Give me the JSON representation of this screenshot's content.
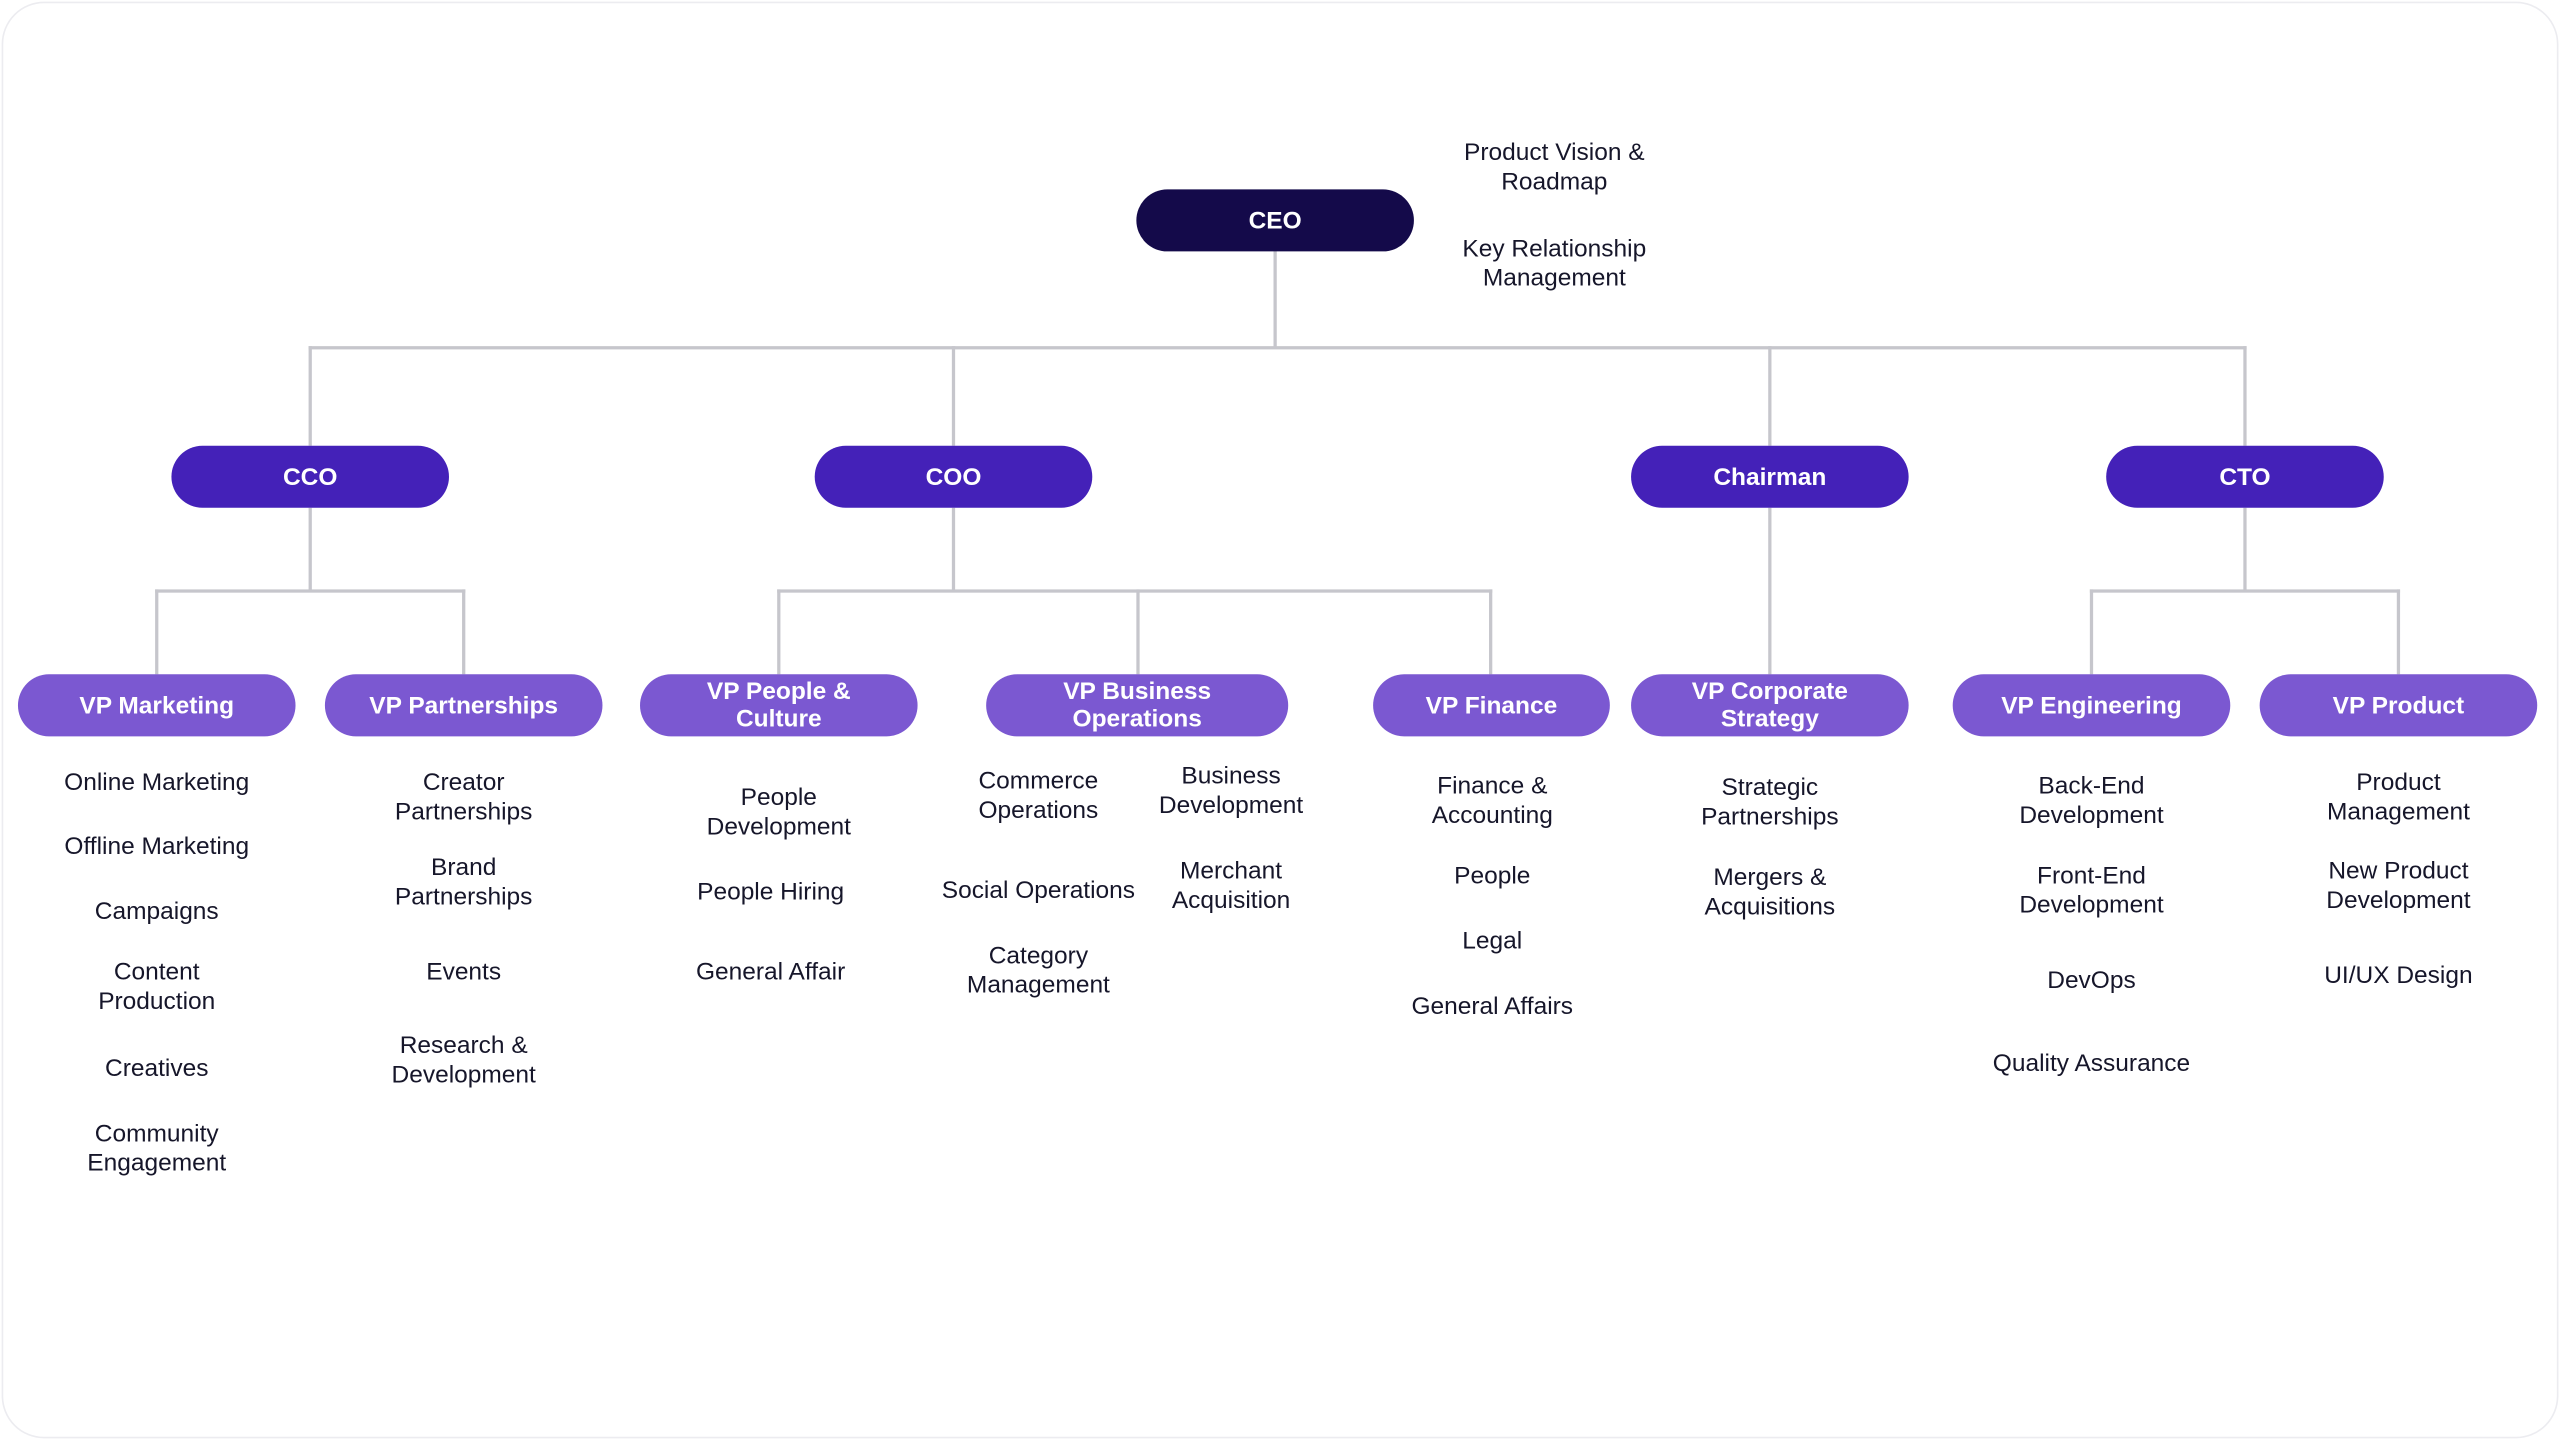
{
  "colors": {
    "ceo": "#140a4a",
    "executive": "#4421b8",
    "vp": "#7b58d1",
    "connector": "#c6c6cc"
  },
  "ceo": {
    "label": "CEO",
    "responsibilities": [
      "Product Vision &\nRoadmap",
      "Key Relationship\nManagement"
    ]
  },
  "executives": [
    {
      "label": "CCO"
    },
    {
      "label": "COO"
    },
    {
      "label": "Chairman"
    },
    {
      "label": "CTO"
    }
  ],
  "vps": [
    {
      "label": "VP Marketing",
      "items": [
        "Online Marketing",
        "Offline Marketing",
        "Campaigns",
        "Content\nProduction",
        "Creatives",
        "Community\nEngagement"
      ]
    },
    {
      "label": "VP Partnerships",
      "items": [
        "Creator\nPartnerships",
        "Brand\nPartnerships",
        "Events",
        "Research &\nDevelopment"
      ]
    },
    {
      "label": "VP People & Culture",
      "items": [
        "People\nDevelopment",
        "People Hiring",
        "General Affair"
      ]
    },
    {
      "label": "VP Business Operations",
      "items": [
        "Commerce\nOperations",
        "Social Operations",
        "Category\nManagement",
        "Business\nDevelopment",
        "Merchant\nAcquisition"
      ]
    },
    {
      "label": "VP Finance",
      "items": [
        "Finance &\nAccounting",
        "People",
        "Legal",
        "General Affairs"
      ]
    },
    {
      "label": "VP Corporate Strategy",
      "items": [
        "Strategic\nPartnerships",
        "Mergers &\nAcquisitions"
      ]
    },
    {
      "label": "VP Engineering",
      "items": [
        "Back-End\nDevelopment",
        "Front-End\nDevelopment",
        "DevOps",
        "Quality Assurance"
      ]
    },
    {
      "label": "VP Product",
      "items": [
        "Product\nManagement",
        "New Product\nDevelopment",
        "UI/UX Design"
      ]
    }
  ]
}
